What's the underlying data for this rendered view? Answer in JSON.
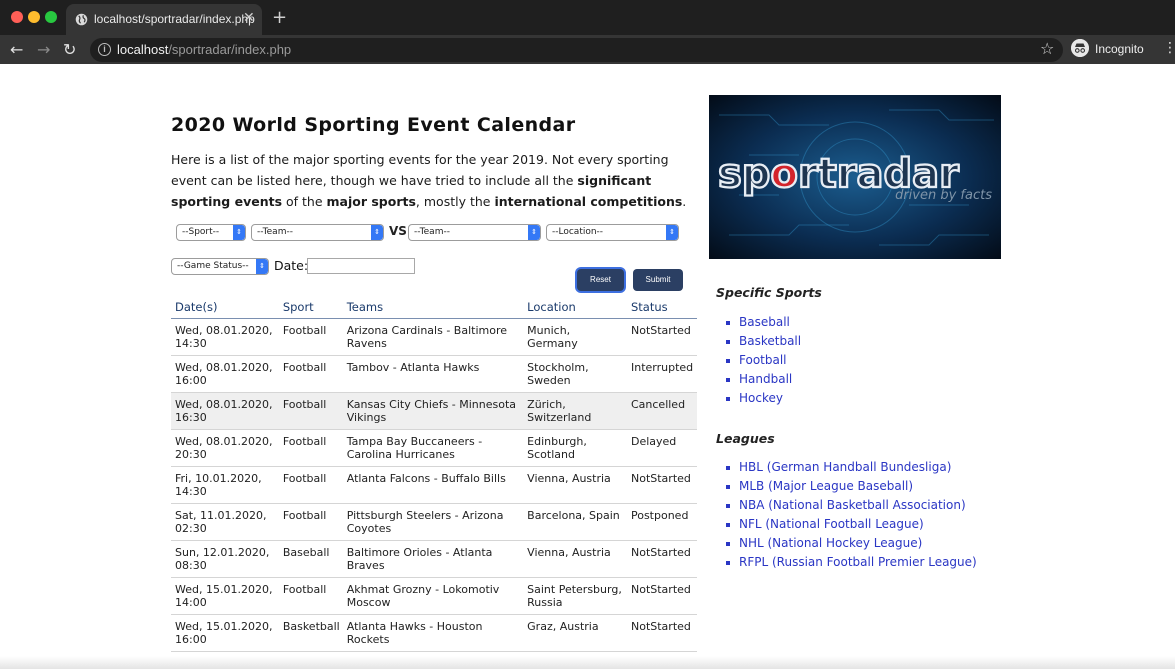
{
  "browser": {
    "tab_title": "localhost/sportradar/index.php",
    "tab_close": "✕",
    "new_tab": "+",
    "url_host": "localhost",
    "url_path": "/sportradar/index.php",
    "profile_label": "Incognito",
    "back": "←",
    "forward": "→",
    "reload": "↻",
    "star": "☆",
    "menu": "⋮"
  },
  "page": {
    "title": "2020 World Sporting Event Calendar",
    "intro_1": "Here is a list of the major sporting events for the year 2019. Not every sporting event can be listed here, though we have tried to include all the ",
    "intro_b1": "significant sporting events",
    "intro_2": " of the ",
    "intro_b2": "major sports",
    "intro_3": ", mostly the ",
    "intro_b3": "international competitions",
    "intro_4": "."
  },
  "filters": {
    "sport": "--Sport--",
    "team1": "--Team--",
    "vs": "VS",
    "team2": "--Team--",
    "location": "--Location--",
    "status": "--Game Status--",
    "date_label": "Date:",
    "reset": "Reset",
    "submit": "Submit"
  },
  "table": {
    "headers": [
      "Date(s)",
      "Sport",
      "Teams",
      "Location",
      "Status"
    ],
    "rows": [
      {
        "date": "Wed, 08.01.2020, 14:30",
        "sport": "Football",
        "teams": "Arizona Cardinals - Baltimore Ravens",
        "location": "Munich, Germany",
        "status": "NotStarted"
      },
      {
        "date": "Wed, 08.01.2020, 16:00",
        "sport": "Football",
        "teams": "Tambov - Atlanta Hawks",
        "location": "Stockholm, Sweden",
        "status": "Interrupted"
      },
      {
        "date": "Wed, 08.01.2020, 16:30",
        "sport": "Football",
        "teams": "Kansas City Chiefs - Minnesota Vikings",
        "location": "Zürich, Switzerland",
        "status": "Cancelled"
      },
      {
        "date": "Wed, 08.01.2020, 20:30",
        "sport": "Football",
        "teams": "Tampa Bay Buccaneers - Carolina Hurricanes",
        "location": "Edinburgh, Scotland",
        "status": "Delayed"
      },
      {
        "date": "Fri, 10.01.2020, 14:30",
        "sport": "Football",
        "teams": "Atlanta Falcons - Buffalo Bills",
        "location": "Vienna, Austria",
        "status": "NotStarted"
      },
      {
        "date": "Sat, 11.01.2020, 02:30",
        "sport": "Football",
        "teams": "Pittsburgh Steelers - Arizona Coyotes",
        "location": "Barcelona, Spain",
        "status": "Postponed"
      },
      {
        "date": "Sun, 12.01.2020, 08:30",
        "sport": "Baseball",
        "teams": "Baltimore Orioles - Atlanta Braves",
        "location": "Vienna, Austria",
        "status": "NotStarted"
      },
      {
        "date": "Wed, 15.01.2020, 14:00",
        "sport": "Football",
        "teams": "Akhmat Grozny - Lokomotiv Moscow",
        "location": "Saint Petersburg, Russia",
        "status": "NotStarted"
      },
      {
        "date": "Wed, 15.01.2020, 16:00",
        "sport": "Basketball",
        "teams": "Atlanta Hawks - Houston Rockets",
        "location": "Graz, Austria",
        "status": "NotStarted"
      }
    ]
  },
  "banner": {
    "brand_pre": "sp",
    "brand_o": "o",
    "brand_post": "rtradar",
    "tagline": "driven by facts"
  },
  "sidebar": {
    "sports_heading": "Specific Sports",
    "sports": [
      "Baseball",
      "Basketball",
      "Football",
      "Handball",
      "Hockey"
    ],
    "leagues_heading": "Leagues",
    "leagues": [
      "HBL (German Handball Bundesliga)",
      "MLB (Major League Baseball)",
      "NBA (National Basketball Association)",
      "NFL (National Football League)",
      "NHL (National Hockey League)",
      "RFPL (Russian Football Premier League)"
    ]
  }
}
